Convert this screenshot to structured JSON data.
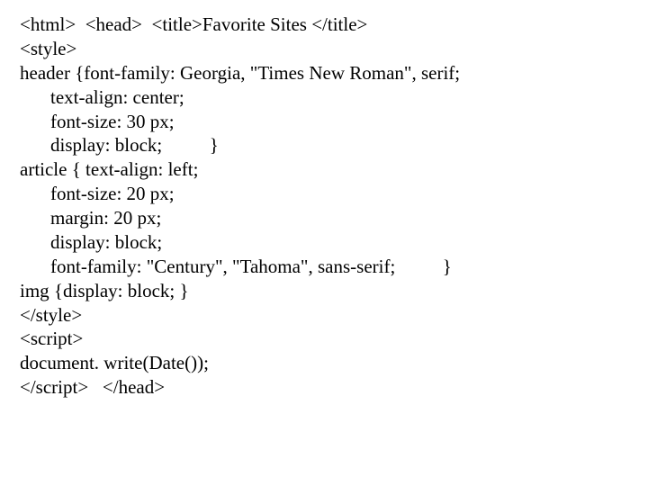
{
  "lines": [
    {
      "text": "<html>  <head>  <title>Favorite Sites </title>",
      "indent": false
    },
    {
      "text": "<style>",
      "indent": false
    },
    {
      "text": "header {font-family: Georgia, \"Times New Roman\", serif;",
      "indent": false
    },
    {
      "text": "text-align: center;",
      "indent": true
    },
    {
      "text": "font-size: 30 px;",
      "indent": true
    },
    {
      "text": "display: block;          }",
      "indent": true
    },
    {
      "text": "article { text-align: left;",
      "indent": false
    },
    {
      "text": "font-size: 20 px;",
      "indent": true
    },
    {
      "text": "margin: 20 px;",
      "indent": true
    },
    {
      "text": "display: block;",
      "indent": true
    },
    {
      "text": "font-family: \"Century\", \"Tahoma\", sans-serif;          }",
      "indent": true
    },
    {
      "text": "img {display: block; }",
      "indent": false
    },
    {
      "text": "</style>",
      "indent": false
    },
    {
      "text": "<script>",
      "indent": false
    },
    {
      "text": "document. write(Date());",
      "indent": false
    },
    {
      "text": "</script>   </head>",
      "indent": false
    }
  ]
}
